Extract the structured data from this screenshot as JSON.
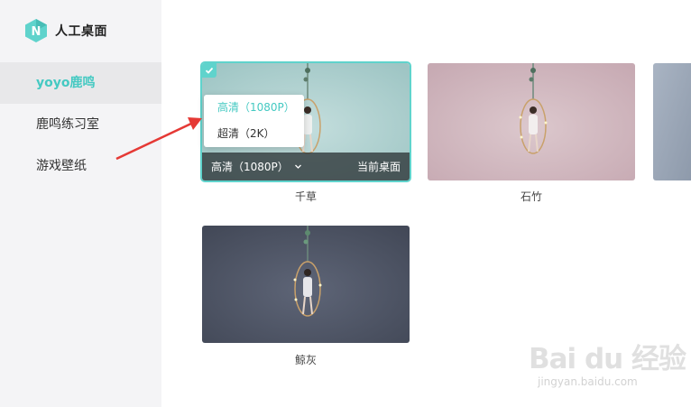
{
  "app": {
    "title": "人工桌面",
    "logo_letter": "N",
    "accent_color": "#44c9c2"
  },
  "sidebar": {
    "items": [
      {
        "label": "yoyo鹿鸣",
        "active": true
      },
      {
        "label": "鹿鸣练习室",
        "active": false
      },
      {
        "label": "游戏壁纸",
        "active": false
      }
    ]
  },
  "wallpapers": [
    {
      "name": "千草",
      "selected": true,
      "resolution": "高清（1080P）",
      "status": "当前桌面",
      "bg": "#a9cccb"
    },
    {
      "name": "石竹",
      "selected": false,
      "bg": "#cdb6bd"
    },
    {
      "name": "",
      "selected": false,
      "bg": "#9aa6b7"
    },
    {
      "name": "鲸灰",
      "selected": false,
      "bg": "#4f5566"
    }
  ],
  "resolution_dropdown": {
    "options": [
      {
        "label": "高清（1080P）",
        "selected": true
      },
      {
        "label": "超清（2K）",
        "selected": false
      }
    ]
  },
  "watermark": {
    "logo": "Bai du 经验",
    "url": "jingyan.baidu.com"
  },
  "icons": {
    "logo": "hexagon-n-logo-icon",
    "check": "check-icon",
    "chevron": "chevron-down-icon",
    "annotation": "red-arrow-annotation"
  }
}
